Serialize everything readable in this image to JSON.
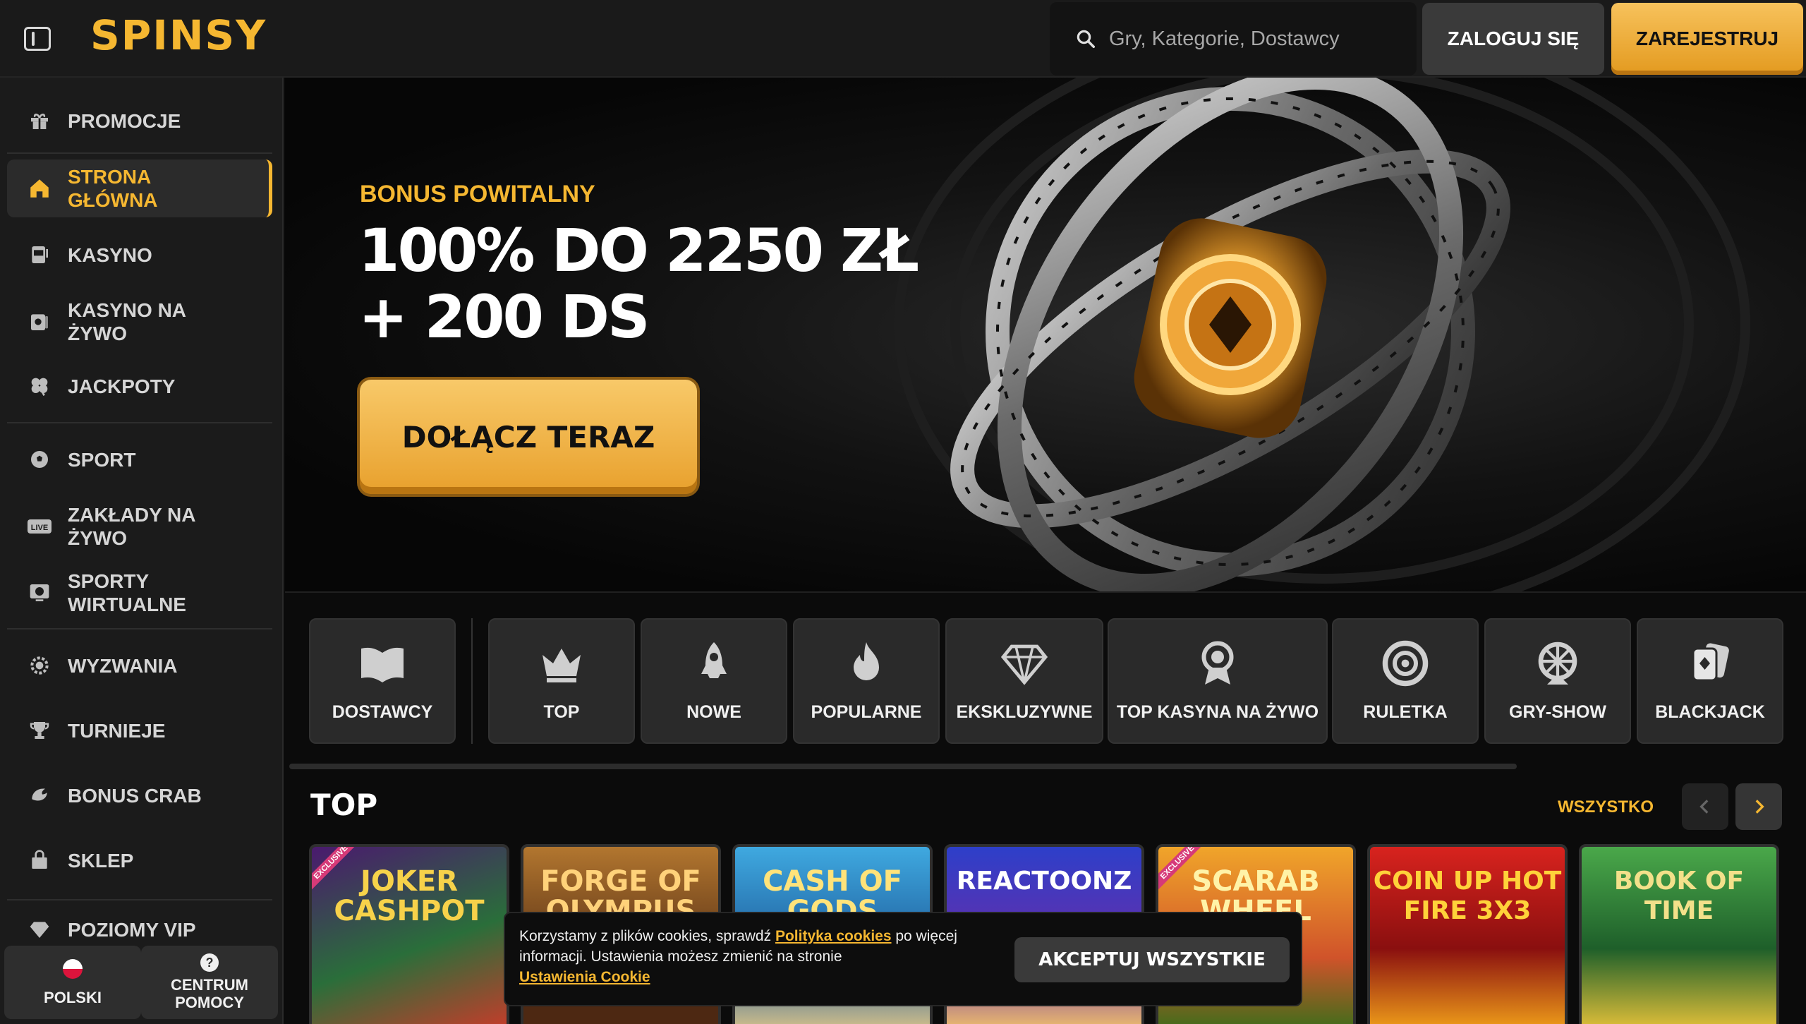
{
  "header": {
    "logo": "SPINSY",
    "search_placeholder": "Gry, Kategorie, Dostawcy",
    "login_label": "ZALOGUJ SIĘ",
    "register_label": "ZAREJESTRUJ"
  },
  "sidebar": {
    "items": [
      {
        "label": "PROMOCJE",
        "icon": "gift-icon"
      },
      {
        "label": "STRONA GŁÓWNA",
        "icon": "home-icon",
        "active": true
      },
      {
        "label": "KASYNO",
        "icon": "slot-machine-icon"
      },
      {
        "label": "KASYNO NA ŻYWO",
        "icon": "live-casino-icon"
      },
      {
        "label": "JACKPOTY",
        "icon": "clover-icon"
      },
      {
        "label": "SPORT",
        "icon": "soccer-ball-icon"
      },
      {
        "label": "ZAKŁADY NA ŻYWO",
        "icon": "live-badge-icon"
      },
      {
        "label": "SPORTY WIRTUALNE",
        "icon": "virtual-sports-icon"
      },
      {
        "label": "WYZWANIA",
        "icon": "challenge-icon"
      },
      {
        "label": "TURNIEJE",
        "icon": "trophy-icon"
      },
      {
        "label": "BONUS CRAB",
        "icon": "crab-claw-icon"
      },
      {
        "label": "SKLEP",
        "icon": "shop-bag-icon"
      },
      {
        "label": "POZIOMY VIP",
        "icon": "diamond-icon"
      }
    ],
    "language_label": "POLSKI",
    "help_label": "CENTRUM POMOCY",
    "help_glyph": "?"
  },
  "banner": {
    "subtitle": "BONUS POWITALNY",
    "title": "100% DO 2250 ZŁ + 200 DS",
    "cta_label": "DOŁĄCZ TERAZ"
  },
  "categories": [
    {
      "label": "DOSTAWCY",
      "icon": "book-icon"
    },
    {
      "label": "TOP",
      "icon": "crown-icon"
    },
    {
      "label": "NOWE",
      "icon": "rocket-icon"
    },
    {
      "label": "POPULARNE",
      "icon": "flame-icon"
    },
    {
      "label": "EKSKLUZYWNE",
      "icon": "diamond-icon"
    },
    {
      "label": "TOP KASYNA NA ŻYWO",
      "icon": "award-icon"
    },
    {
      "label": "RULETKA",
      "icon": "roulette-icon"
    },
    {
      "label": "GRY-SHOW",
      "icon": "wheel-show-icon"
    },
    {
      "label": "BLACKJACK",
      "icon": "cards-icon"
    }
  ],
  "top_section": {
    "title": "TOP",
    "see_all_label": "WSZYSTKO",
    "games": [
      {
        "title": "JOKER CASHPOT",
        "exclusive": true,
        "badge": "EXCLUSIVE"
      },
      {
        "title": "FORGE OF OLYMPUS",
        "exclusive": false
      },
      {
        "title": "CASH OF GODS",
        "exclusive": false
      },
      {
        "title": "REACTOONZ",
        "exclusive": false
      },
      {
        "title": "SCARAB WHEEL",
        "exclusive": true,
        "badge": "EXCLUSIVE"
      },
      {
        "title": "COIN UP HOT FIRE 3X3",
        "exclusive": false
      },
      {
        "title": "BOOK OF TIME",
        "exclusive": false
      }
    ]
  },
  "cookie": {
    "text_before": "Korzystamy z plików cookies, sprawdź ",
    "policy_link": "Polityka cookies",
    "text_after": " po więcej informacji. Ustawienia możesz zmienić na stronie",
    "settings_link": "Ustawienia Cookie",
    "accept_label": "AKCEPTUJ WSZYSTKIE"
  },
  "colors": {
    "accent": "#f5b731",
    "background": "#0b0b0b",
    "sidebar": "#1b1b1b",
    "card": "#2a2a2a"
  }
}
